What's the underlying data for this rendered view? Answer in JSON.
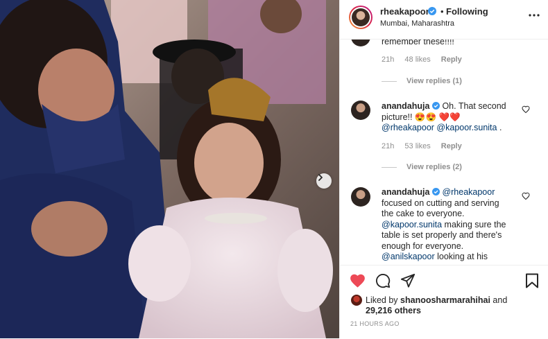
{
  "header": {
    "username": "rheakapoor",
    "separator": "•",
    "follow_status": "Following",
    "location": "Mumbai, Maharashtra"
  },
  "comments": [
    {
      "partial_text": "remember these!!!!",
      "time": "21h",
      "likes": "48 likes",
      "reply_label": "Reply",
      "view_replies": "View replies (1)"
    },
    {
      "username": "anandahuja",
      "lines": [
        "Oh. That second",
        "picture!! 😍😍 ❤️❤️"
      ],
      "mentions": [
        "@rheakapoor",
        "@kapoor.sunita"
      ],
      "end": ".",
      "time": "21h",
      "likes": "53 likes",
      "reply_label": "Reply",
      "view_replies": "View replies (2)"
    },
    {
      "username": "anandahuja",
      "mention_first": "@rheakapoor",
      "line1": "focused on cutting and serving",
      "line2": "the cake to everyone.",
      "mention2": "@kapoor.sunita",
      "line3": " making sure the",
      "line4": "table is set properly and there's",
      "line5": "enough for everyone.",
      "mention3": "@anilskapoor",
      "line6": " looking at his"
    }
  ],
  "footer": {
    "liked_by_prefix": "Liked by ",
    "liked_by_user": "shanoosharmarahihai",
    "liked_by_and": " and",
    "liked_count": "29,216 others",
    "timestamp": "21 HOURS AGO"
  },
  "colors": {
    "heart": "#ed4956",
    "verified": "#3897f0",
    "mention": "#00376b",
    "muted": "#8e8e8e"
  },
  "icons": [
    "heart-filled-icon",
    "comment-icon",
    "share-icon",
    "bookmark-icon",
    "verified-icon",
    "more-options-icon",
    "heart-outline-icon",
    "chevron-right-icon"
  ]
}
